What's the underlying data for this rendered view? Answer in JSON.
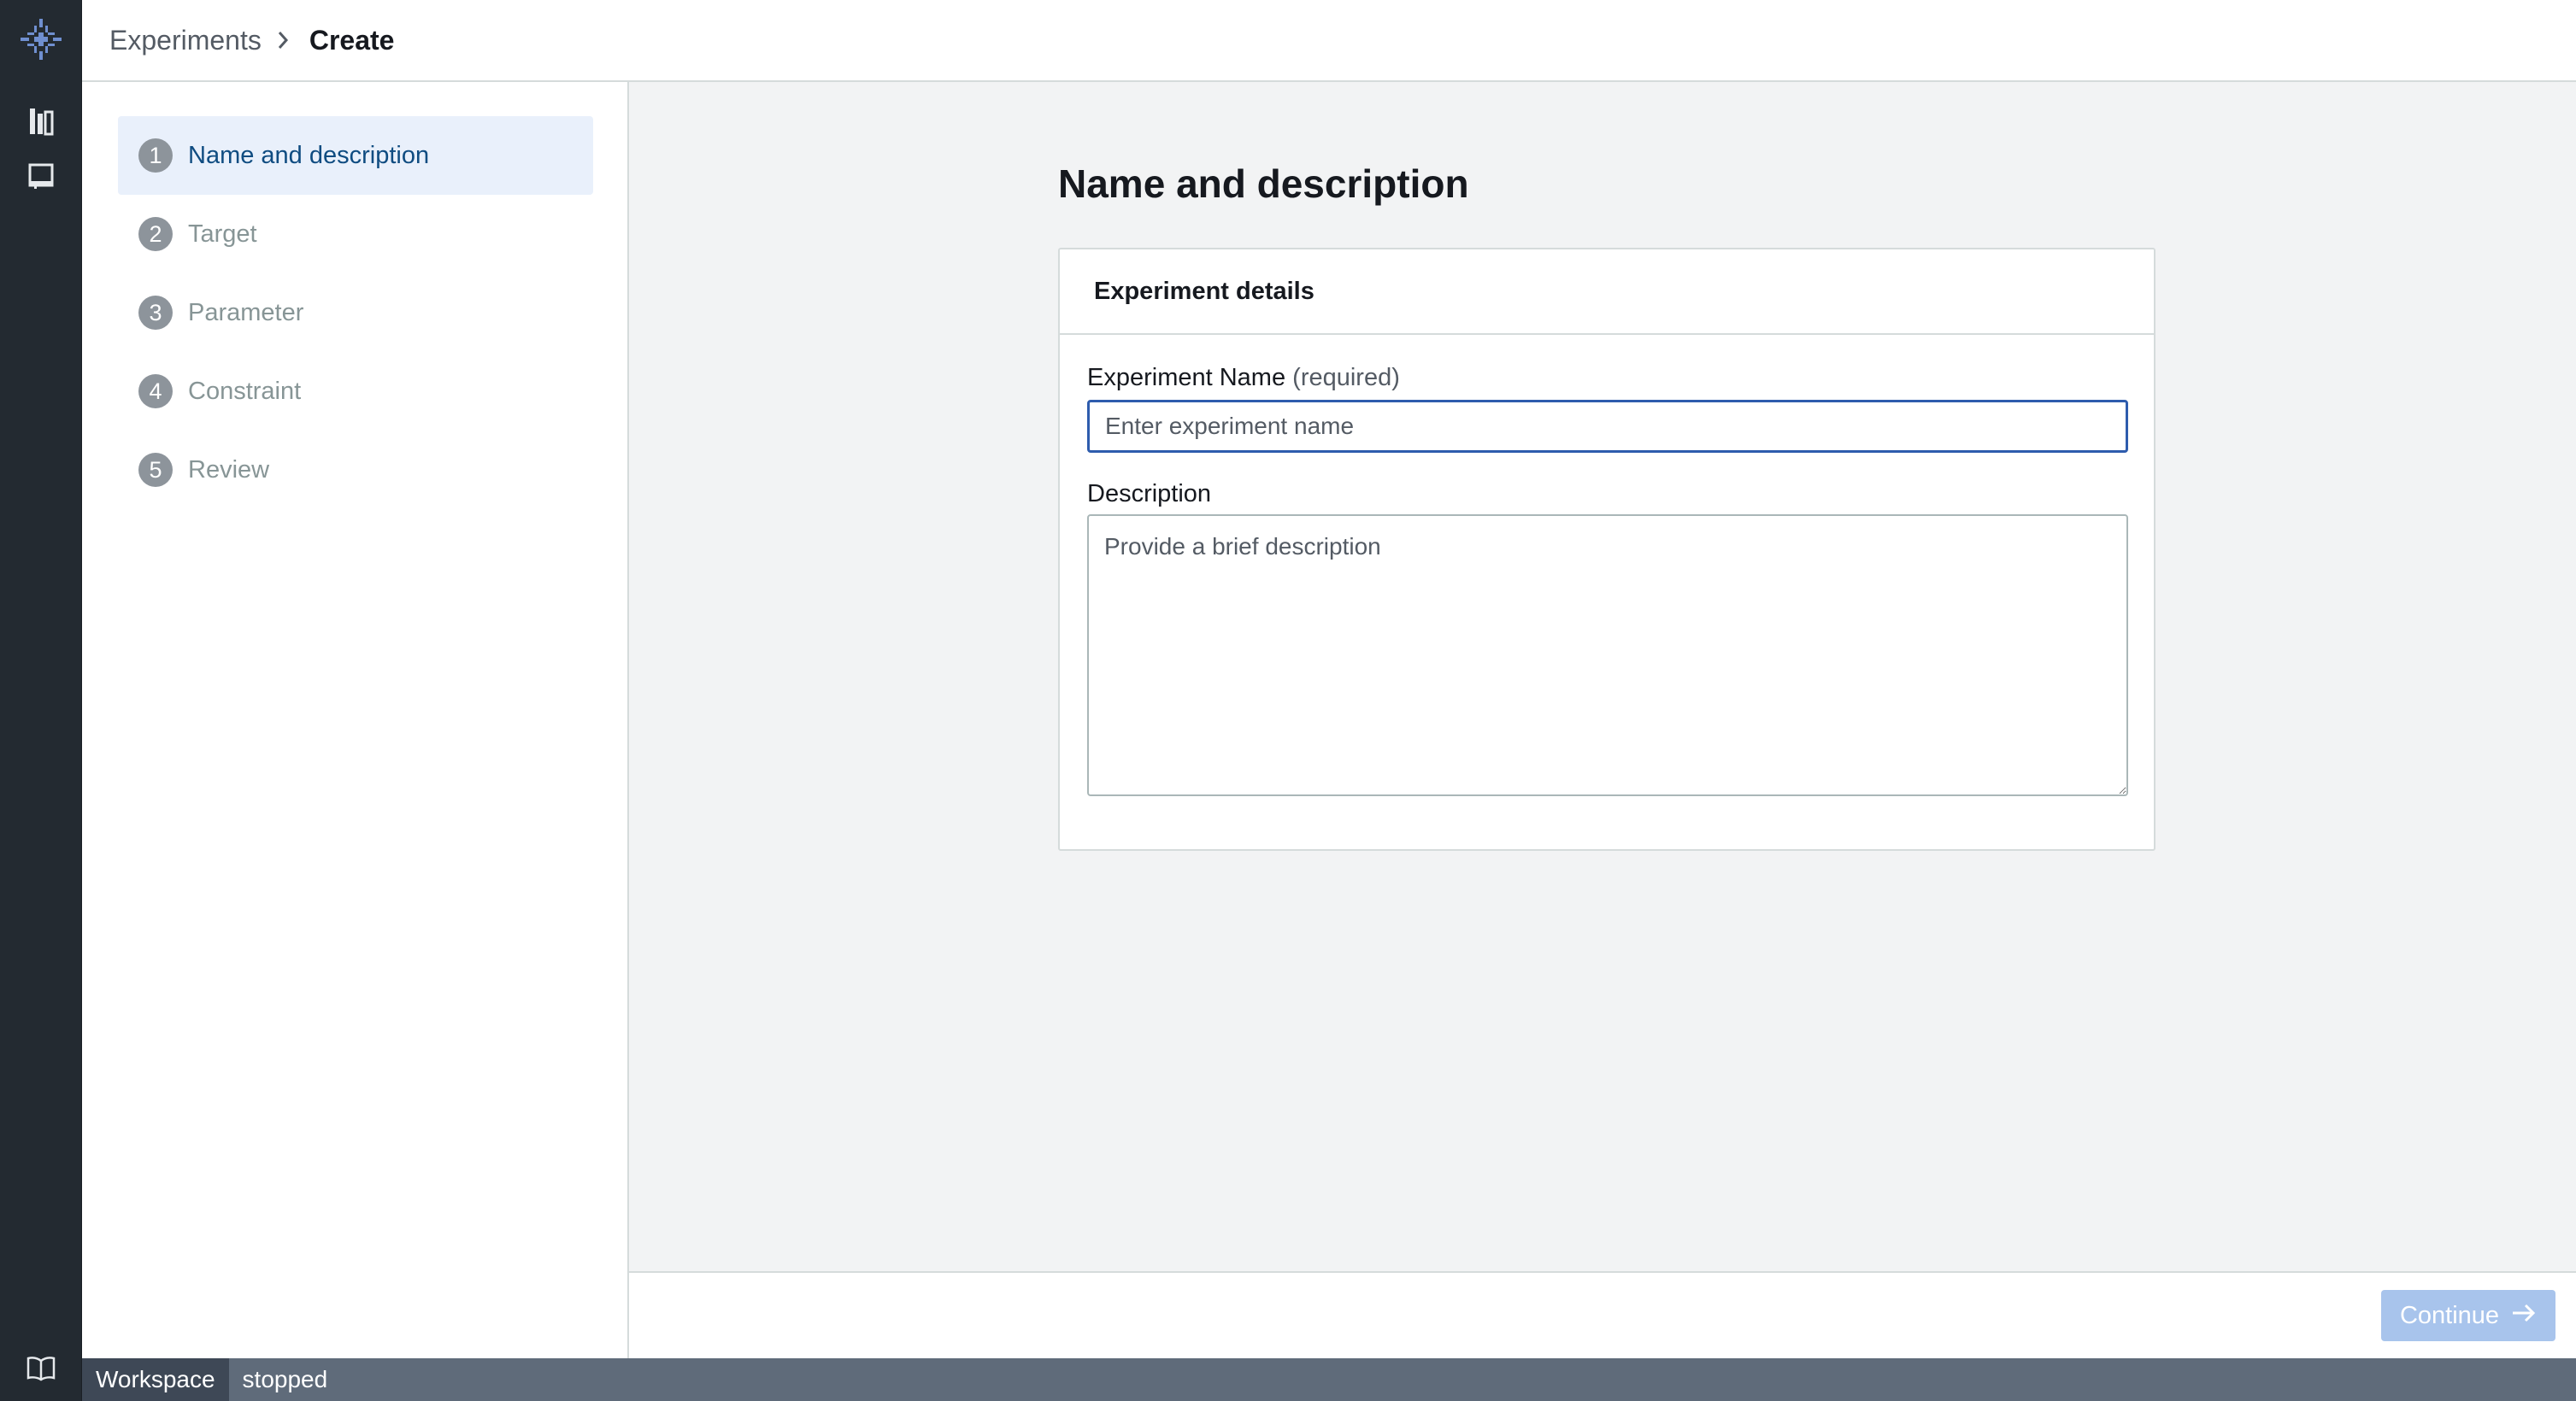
{
  "breadcrumb": {
    "parent": "Experiments",
    "current": "Create"
  },
  "steps": [
    {
      "number": "1",
      "label": "Name and description",
      "active": true
    },
    {
      "number": "2",
      "label": "Target",
      "active": false
    },
    {
      "number": "3",
      "label": "Parameter",
      "active": false
    },
    {
      "number": "4",
      "label": "Constraint",
      "active": false
    },
    {
      "number": "5",
      "label": "Review",
      "active": false
    }
  ],
  "main": {
    "title": "Name and description",
    "card_title": "Experiment details",
    "name_label": "Experiment Name",
    "name_required": "(required)",
    "name_placeholder": "Enter experiment name",
    "name_value": "",
    "description_label": "Description",
    "description_placeholder": "Provide a brief description",
    "description_value": ""
  },
  "footer": {
    "continue_label": "Continue"
  },
  "statusbar": {
    "workspace_label": "Workspace",
    "workspace_status": "stopped"
  },
  "icons": {
    "logo": "app-logo-icon",
    "rail_top": "library-icon",
    "rail_second": "notebook-icon",
    "rail_bottom": "book-icon",
    "continue": "arrow-right-icon",
    "breadcrumb_separator": "chevron-right-icon"
  },
  "colors": {
    "accent": "#2e5cad",
    "active_step_bg": "#e9f0fb",
    "disabled_button": "#a8c4ec",
    "rail_bg": "#232a31"
  }
}
